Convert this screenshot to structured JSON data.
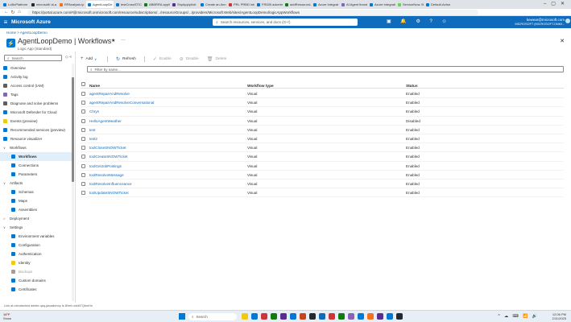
{
  "browser": {
    "tabs": [
      {
        "label": "LoBoPlatform",
        "active": false,
        "color": "#0078d4"
      },
      {
        "label": "microsoft/ ai-a",
        "active": false,
        "color": "#24292f"
      },
      {
        "label": "RPAnalysis.ip",
        "active": false,
        "color": "#f2711c"
      },
      {
        "label": "AgentLoopDe",
        "active": true,
        "color": "#0078d4"
      },
      {
        "label": "testCrossSTIC",
        "active": false,
        "color": "#0078d4"
      },
      {
        "label": "ABBRRA appli",
        "active": false,
        "color": "#107c10"
      },
      {
        "label": "ShyApp/piloti",
        "active": false,
        "color": "#5c2d91"
      },
      {
        "label": "Create an Ann",
        "active": false,
        "color": "#0078d4"
      },
      {
        "label": "PRL PRBD inbo",
        "active": false,
        "color": "#d13438"
      },
      {
        "label": "FRIDB adcerim",
        "active": false,
        "color": "#0078d4"
      },
      {
        "label": "addResourceU",
        "active": false,
        "color": "#107c10"
      },
      {
        "label": "Azure Integrat",
        "active": false,
        "color": "#0078d4"
      },
      {
        "label": "AI Agent tbond",
        "active": false,
        "color": "#8764b8"
      },
      {
        "label": "Azure Integrati",
        "active": false,
        "color": "#0078d4"
      },
      {
        "label": "ServiceNow. B",
        "active": false,
        "color": "#62d84e"
      },
      {
        "label": "Default-Azfun",
        "active": false,
        "color": "#0078d4"
      }
    ],
    "url": "https://portal.azure.com/#@microsoft.onmicrosoft.com/resource/subscriptions/.../resourceGroups/.../providers/Microsoft.Web/sites/AgentLoopDemo/logicAppWorkflows"
  },
  "header": {
    "brand": "Microsoft Azure",
    "search_placeholder": "Search resources, services, and docs (G+/)",
    "account_name": "kewear@microsoft.com",
    "account_org": "MICROSOFT (MICROSOFT.ONMI..."
  },
  "breadcrumb": "Home  >  AgentLoopDemo",
  "resource": {
    "title": "AgentLoopDemo | Workflows",
    "subtitle": "Logic App (Standard)"
  },
  "sidebar": {
    "search_placeholder": "Search",
    "items": [
      {
        "label": "Overview",
        "level": 0,
        "icon_color": "#0078d4",
        "chev": ""
      },
      {
        "label": "Activity log",
        "level": 0,
        "icon_color": "#0078d4",
        "chev": ""
      },
      {
        "label": "Access control (IAM)",
        "level": 0,
        "icon_color": "#605e5c",
        "chev": ""
      },
      {
        "label": "Tags",
        "level": 0,
        "icon_color": "#8764b8",
        "chev": ""
      },
      {
        "label": "Diagnose and solve problems",
        "level": 0,
        "icon_color": "#605e5c",
        "chev": ""
      },
      {
        "label": "Microsoft Defender for Cloud",
        "level": 0,
        "icon_color": "#0078d4",
        "chev": ""
      },
      {
        "label": "Events (preview)",
        "level": 0,
        "icon_color": "#f2c811",
        "chev": ""
      },
      {
        "label": "Recommended services (preview)",
        "level": 0,
        "icon_color": "#0078d4",
        "chev": ""
      },
      {
        "label": "Resource visualizer",
        "level": 0,
        "icon_color": "#0078d4",
        "chev": ""
      },
      {
        "label": "Workflows",
        "level": 0,
        "icon_color": "",
        "chev": "∨"
      },
      {
        "label": "Workflows",
        "level": 1,
        "icon_color": "#0078d4",
        "chev": "",
        "selected": true
      },
      {
        "label": "Connections",
        "level": 1,
        "icon_color": "#0078d4",
        "chev": ""
      },
      {
        "label": "Parameters",
        "level": 1,
        "icon_color": "#0078d4",
        "chev": ""
      },
      {
        "label": "Artifacts",
        "level": 0,
        "icon_color": "",
        "chev": "∨"
      },
      {
        "label": "Schemas",
        "level": 1,
        "icon_color": "#0078d4",
        "chev": ""
      },
      {
        "label": "Maps",
        "level": 1,
        "icon_color": "#0078d4",
        "chev": ""
      },
      {
        "label": "Assemblies",
        "level": 1,
        "icon_color": "#0078d4",
        "chev": ""
      },
      {
        "label": "Deployment",
        "level": 0,
        "icon_color": "",
        "chev": ">"
      },
      {
        "label": "Settings",
        "level": 0,
        "icon_color": "",
        "chev": "∨"
      },
      {
        "label": "Environment variables",
        "level": 1,
        "icon_color": "#0078d4",
        "chev": ""
      },
      {
        "label": "Configuration",
        "level": 1,
        "icon_color": "#0078d4",
        "chev": ""
      },
      {
        "label": "Authentication",
        "level": 1,
        "icon_color": "#0078d4",
        "chev": ""
      },
      {
        "label": "Identity",
        "level": 1,
        "icon_color": "#f2c811",
        "chev": ""
      },
      {
        "label": "Backups",
        "level": 1,
        "icon_color": "#a19f9d",
        "chev": "",
        "muted": true
      },
      {
        "label": "Custom domains",
        "level": 1,
        "icon_color": "#0078d4",
        "chev": ""
      },
      {
        "label": "Certificates",
        "level": 1,
        "icon_color": "#0078d4",
        "chev": ""
      }
    ]
  },
  "toolbar": {
    "add": "Add",
    "refresh": "Refresh",
    "enable": "Enable",
    "disable": "Disable",
    "delete": "Delete"
  },
  "filter_placeholder": "Filter by name...",
  "grid": {
    "columns": {
      "name": "Name",
      "type": "Workflow type",
      "status": "Status"
    },
    "rows": [
      {
        "name": "agentRepairAndResolve",
        "type": "Visual",
        "status": "Enabled"
      },
      {
        "name": "agentRepairAndResolveConversational",
        "type": "Visual",
        "status": "Enabled"
      },
      {
        "name": "Chrys",
        "type": "Visual",
        "status": "Enabled"
      },
      {
        "name": "HelloAgentWeather",
        "type": "Visual",
        "status": "Disabled"
      },
      {
        "name": "test",
        "type": "Visual",
        "status": "Enabled"
      },
      {
        "name": "test2",
        "type": "Visual",
        "status": "Enabled"
      },
      {
        "name": "toolCloseSNOWTicket",
        "type": "Visual",
        "status": "Enabled"
      },
      {
        "name": "toolCreateSNOWTicket",
        "type": "Visual",
        "status": "Enabled"
      },
      {
        "name": "toolGetJobPostings",
        "type": "Visual",
        "status": "Enabled"
      },
      {
        "name": "toolResolveMessage",
        "type": "Visual",
        "status": "Enabled"
      },
      {
        "name": "toolResolveInfluenceance",
        "type": "Visual",
        "status": "Enabled"
      },
      {
        "name": "toolUpdateSNOWTicket",
        "type": "Visual",
        "status": "Enabled"
      }
    ]
  },
  "statusbar": "Link at-minuteshed delete qaq-janaatenny is 80ref-ndxM7QbmHn",
  "taskbar": {
    "weather_temp": "18°F",
    "weather_desc": "Snow",
    "search_placeholder": "Search",
    "time": "12:06 PM",
    "date": "2/11/2025",
    "app_colors": [
      "#f2c811",
      "#0078d4",
      "#d13438",
      "#107c10",
      "#5c2d91",
      "#0078d4",
      "#c8451c",
      "#24292f",
      "#0f6cbd",
      "#d13438",
      "#107c10",
      "#8764b8",
      "#0078d4",
      "#f2711c",
      "#5c2d91",
      "#0078d4",
      "#24292f"
    ]
  }
}
